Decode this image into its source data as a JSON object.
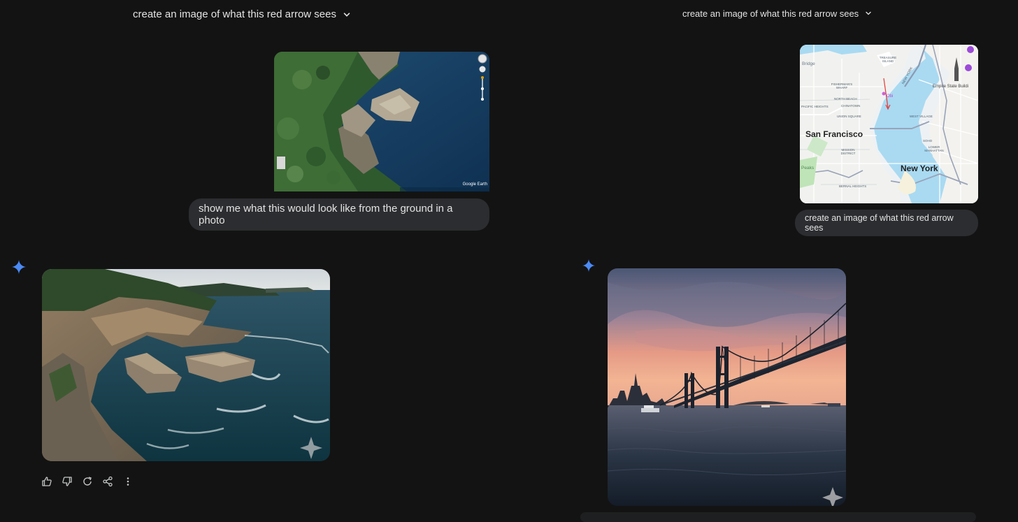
{
  "left": {
    "header_title": "create an image of what this red arrow sees",
    "user_image": {
      "attribution": "Google Earth",
      "alt": "Aerial satellite view of a rocky coastline with a rock outcrop in deep blue water"
    },
    "user_prompt": "show me what this would look like from the ground in a photo",
    "response_image": {
      "alt": "Photo of sandstone cliffs and rock platforms with waves crashing on a coast"
    },
    "actions": [
      "Good response",
      "Bad response",
      "Redo",
      "Share",
      "More"
    ]
  },
  "right": {
    "header_title": "create an image of what this red arrow sees",
    "map_labels": {
      "city1": "San Francisco",
      "city2": "New York",
      "treasure_island": "TREASURE ISLAND",
      "fishermans_wharf": "FISHERMAN'S WHARF",
      "north_beach": "NORTH BEACH",
      "chinatown": "CHINATOWN",
      "pacific_heights": "PACIFIC HEIGHTS",
      "union_square": "UNION SQUARE",
      "mission_district": "MISSION DISTRICT",
      "bernal_heights": "BERNAL HEIGHTS",
      "west_village": "WEST VILLAGE",
      "soho": "SOHO",
      "lower_manhattan": "LOWER MANHATTAN",
      "empire_state": "Empire State Buildi",
      "bridge": "Bridge",
      "peaks": "Peaks",
      "new_york_street": "NEW YORK",
      "obi": "Obi"
    },
    "user_prompt": "create an image of what this red arrow sees",
    "response_image": {
      "alt": "Sunset photo of a suspension bridge over a bay with a city skyline and ferry"
    }
  },
  "colors": {
    "background": "#131313",
    "bubble": "#2c2d30",
    "sparkle": "#4b8af5",
    "text": "#e3e3e3"
  }
}
